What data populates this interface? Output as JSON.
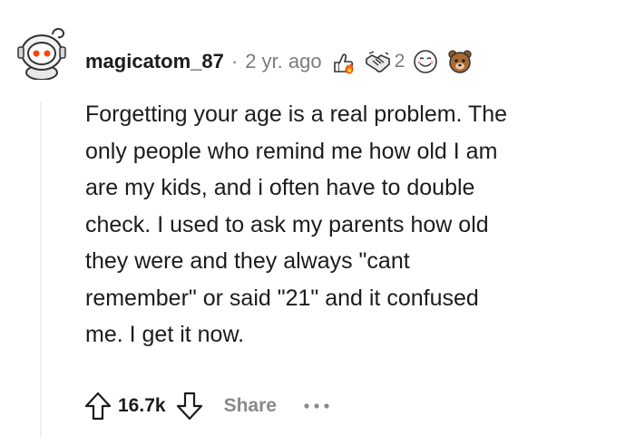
{
  "comment": {
    "author": "magicatom_87",
    "separator": "·",
    "age": "2 yr. ago",
    "awards": [
      {
        "icon": "thumbs-up-fire-award-icon"
      },
      {
        "icon": "handshake-award-icon",
        "count": "2"
      },
      {
        "icon": "smiling-face-award-icon"
      },
      {
        "icon": "bear-award-icon"
      }
    ],
    "body_lines": [
      "Forgetting your age is a real problem. The",
      "only people who remind me how old I am",
      "are my kids, and i often have to double",
      "check. I used to ask my parents how old",
      "they were and they always \"cant",
      "remember\" or said \"21\" and it confused",
      "me. I get it now."
    ]
  },
  "actions": {
    "upvote_icon": "upvote-arrow-icon",
    "score": "16.7k",
    "downvote_icon": "downvote-arrow-icon",
    "share_label": "Share",
    "more_icon": "more-options-icon"
  },
  "colors": {
    "text": "#1c1c1c",
    "meta": "#7c7c7c",
    "action_gray": "#878a8c",
    "thread_line": "#edeff1"
  }
}
